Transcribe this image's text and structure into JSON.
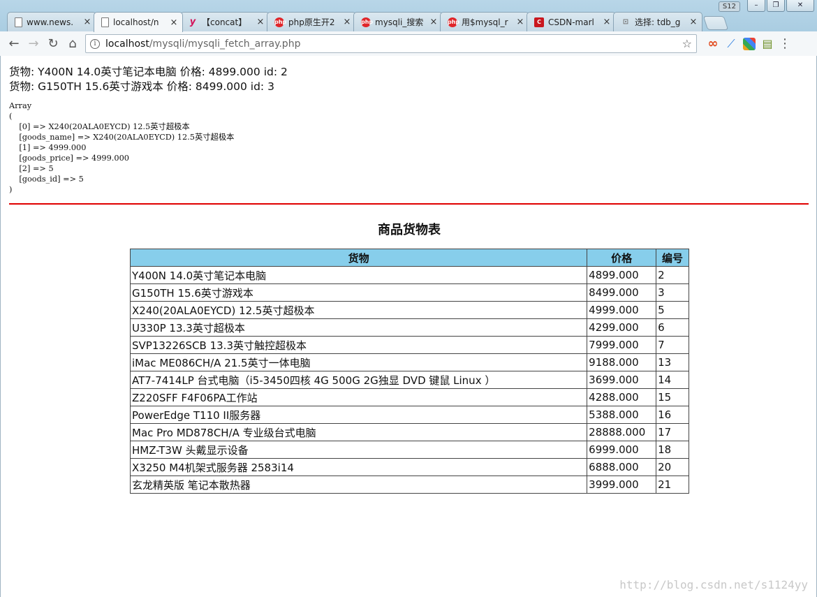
{
  "window": {
    "profile": "S12",
    "min_icon": "–",
    "max_icon": "❐",
    "close_icon": "✕"
  },
  "tabs": [
    {
      "label": "www.news.",
      "icon": "doc",
      "active": false
    },
    {
      "label": "localhost/n",
      "icon": "doc",
      "active": true
    },
    {
      "label": "【concat】",
      "icon": "yahoo",
      "active": false
    },
    {
      "label": "php原生开2",
      "icon": "php",
      "active": false
    },
    {
      "label": "mysqli_搜索",
      "icon": "php",
      "active": false
    },
    {
      "label": "用$mysql_r",
      "icon": "php",
      "active": false
    },
    {
      "label": "CSDN-marl",
      "icon": "csdn",
      "active": false
    },
    {
      "label": "选择: tdb_g",
      "icon": "lock",
      "active": false
    }
  ],
  "toolbar": {
    "back": "←",
    "forward": "→",
    "reload": "↻",
    "home": "⌂",
    "url_host": "localhost",
    "url_path": "/mysqli/mysqli_fetch_array.php",
    "star": "☆",
    "menu": "⋮"
  },
  "page": {
    "echo_lines": [
      "货物: Y400N 14.0英寸笔记本电脑 价格: 4899.000 id: 2",
      "货物: G150TH 15.6英寸游戏本 价格: 8499.000 id: 3"
    ],
    "print_r": "Array\n(\n    [0] => X240(20ALA0EYCD) 12.5英寸超极本\n    [goods_name] => X240(20ALA0EYCD) 12.5英寸超极本\n    [1] => 4999.000\n    [goods_price] => 4999.000\n    [2] => 5\n    [goods_id] => 5\n)",
    "table_title": "商品货物表",
    "columns": [
      "货物",
      "价格",
      "编号"
    ],
    "rows": [
      [
        "Y400N 14.0英寸笔记本电脑",
        "4899.000",
        "2"
      ],
      [
        "G150TH 15.6英寸游戏本",
        "8499.000",
        "3"
      ],
      [
        "X240(20ALA0EYCD) 12.5英寸超极本",
        "4999.000",
        "5"
      ],
      [
        "U330P 13.3英寸超极本",
        "4299.000",
        "6"
      ],
      [
        "SVP13226SCB 13.3英寸触控超极本",
        "7999.000",
        "7"
      ],
      [
        "iMac ME086CH/A 21.5英寸一体电脑",
        "9188.000",
        "13"
      ],
      [
        "AT7-7414LP 台式电脑（i5-3450四核 4G 500G 2G独显 DVD 键鼠 Linux ）",
        "3699.000",
        "14"
      ],
      [
        "Z220SFF F4F06PA工作站",
        "4288.000",
        "15"
      ],
      [
        "PowerEdge T110 II服务器",
        "5388.000",
        "16"
      ],
      [
        "Mac Pro MD878CH/A 专业级台式电脑",
        "28888.000",
        "17"
      ],
      [
        "HMZ-T3W 头戴显示设备",
        "6999.000",
        "18"
      ],
      [
        "X3250 M4机架式服务器 2583i14",
        "6888.000",
        "20"
      ],
      [
        "玄龙精英版 笔记本散热器",
        "3999.000",
        "21"
      ]
    ],
    "watermark": "http://blog.csdn.net/s1124yy"
  },
  "colors": {
    "header_bg": "#87ceeb",
    "rule": "#e00000"
  }
}
